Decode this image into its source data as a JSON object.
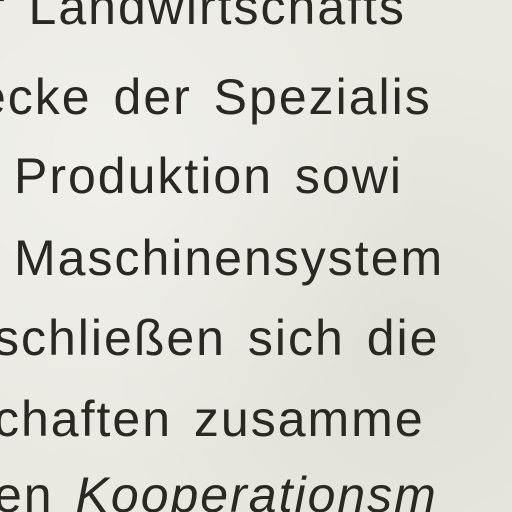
{
  "document": {
    "lines": [
      "r Landwirtschafts",
      "ecke der Spezialis",
      "Produktion sowi",
      "Maschinensystem",
      "schließen sich die",
      "chaften zusamme",
      "en"
    ],
    "italic_fragment": "Kooperationsm"
  }
}
